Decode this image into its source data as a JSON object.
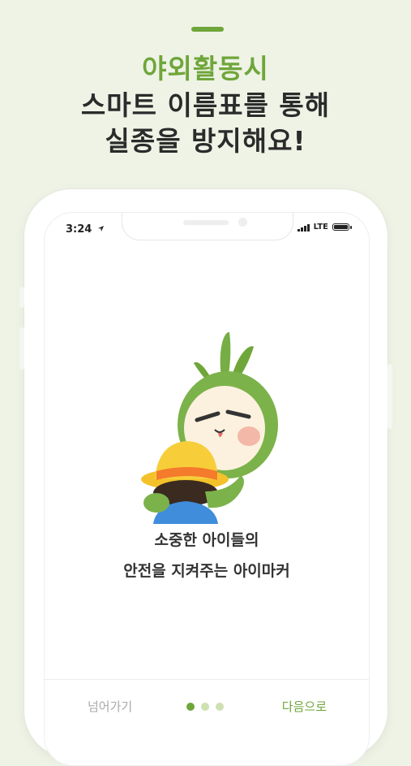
{
  "headline": {
    "line1": "야외활동시",
    "line2": "스마트 이름표를 통해",
    "line3": "실종을 방지해요!"
  },
  "status_bar": {
    "time": "3:24",
    "network": "LTE"
  },
  "onboarding": {
    "caption_line1": "소중한 아이들의",
    "caption_line2": "안전을 지켜주는 아이마커",
    "skip_label": "넘어가기",
    "next_label": "다음으로",
    "page_count": 3,
    "current_page": 1
  },
  "colors": {
    "accent": "#6fa63a",
    "background": "#eef3e6",
    "dot_inactive": "#cfe0b2"
  },
  "icons": [
    "location-arrow-icon",
    "signal-icon",
    "battery-icon"
  ]
}
